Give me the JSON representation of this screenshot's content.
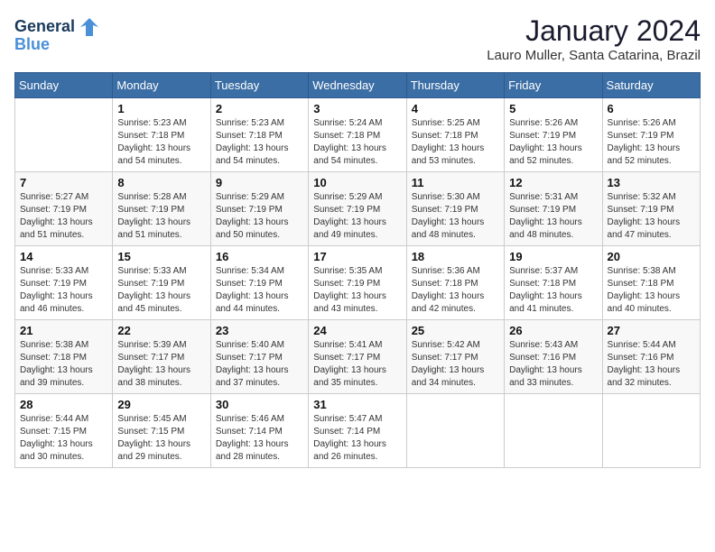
{
  "header": {
    "logo_line1": "General",
    "logo_line2": "Blue",
    "title": "January 2024",
    "subtitle": "Lauro Muller, Santa Catarina, Brazil"
  },
  "weekdays": [
    "Sunday",
    "Monday",
    "Tuesday",
    "Wednesday",
    "Thursday",
    "Friday",
    "Saturday"
  ],
  "weeks": [
    [
      {
        "day": "",
        "sunrise": "",
        "sunset": "",
        "daylight": ""
      },
      {
        "day": "1",
        "sunrise": "Sunrise: 5:23 AM",
        "sunset": "Sunset: 7:18 PM",
        "daylight": "Daylight: 13 hours and 54 minutes."
      },
      {
        "day": "2",
        "sunrise": "Sunrise: 5:23 AM",
        "sunset": "Sunset: 7:18 PM",
        "daylight": "Daylight: 13 hours and 54 minutes."
      },
      {
        "day": "3",
        "sunrise": "Sunrise: 5:24 AM",
        "sunset": "Sunset: 7:18 PM",
        "daylight": "Daylight: 13 hours and 54 minutes."
      },
      {
        "day": "4",
        "sunrise": "Sunrise: 5:25 AM",
        "sunset": "Sunset: 7:18 PM",
        "daylight": "Daylight: 13 hours and 53 minutes."
      },
      {
        "day": "5",
        "sunrise": "Sunrise: 5:26 AM",
        "sunset": "Sunset: 7:19 PM",
        "daylight": "Daylight: 13 hours and 52 minutes."
      },
      {
        "day": "6",
        "sunrise": "Sunrise: 5:26 AM",
        "sunset": "Sunset: 7:19 PM",
        "daylight": "Daylight: 13 hours and 52 minutes."
      }
    ],
    [
      {
        "day": "7",
        "sunrise": "Sunrise: 5:27 AM",
        "sunset": "Sunset: 7:19 PM",
        "daylight": "Daylight: 13 hours and 51 minutes."
      },
      {
        "day": "8",
        "sunrise": "Sunrise: 5:28 AM",
        "sunset": "Sunset: 7:19 PM",
        "daylight": "Daylight: 13 hours and 51 minutes."
      },
      {
        "day": "9",
        "sunrise": "Sunrise: 5:29 AM",
        "sunset": "Sunset: 7:19 PM",
        "daylight": "Daylight: 13 hours and 50 minutes."
      },
      {
        "day": "10",
        "sunrise": "Sunrise: 5:29 AM",
        "sunset": "Sunset: 7:19 PM",
        "daylight": "Daylight: 13 hours and 49 minutes."
      },
      {
        "day": "11",
        "sunrise": "Sunrise: 5:30 AM",
        "sunset": "Sunset: 7:19 PM",
        "daylight": "Daylight: 13 hours and 48 minutes."
      },
      {
        "day": "12",
        "sunrise": "Sunrise: 5:31 AM",
        "sunset": "Sunset: 7:19 PM",
        "daylight": "Daylight: 13 hours and 48 minutes."
      },
      {
        "day": "13",
        "sunrise": "Sunrise: 5:32 AM",
        "sunset": "Sunset: 7:19 PM",
        "daylight": "Daylight: 13 hours and 47 minutes."
      }
    ],
    [
      {
        "day": "14",
        "sunrise": "Sunrise: 5:33 AM",
        "sunset": "Sunset: 7:19 PM",
        "daylight": "Daylight: 13 hours and 46 minutes."
      },
      {
        "day": "15",
        "sunrise": "Sunrise: 5:33 AM",
        "sunset": "Sunset: 7:19 PM",
        "daylight": "Daylight: 13 hours and 45 minutes."
      },
      {
        "day": "16",
        "sunrise": "Sunrise: 5:34 AM",
        "sunset": "Sunset: 7:19 PM",
        "daylight": "Daylight: 13 hours and 44 minutes."
      },
      {
        "day": "17",
        "sunrise": "Sunrise: 5:35 AM",
        "sunset": "Sunset: 7:19 PM",
        "daylight": "Daylight: 13 hours and 43 minutes."
      },
      {
        "day": "18",
        "sunrise": "Sunrise: 5:36 AM",
        "sunset": "Sunset: 7:18 PM",
        "daylight": "Daylight: 13 hours and 42 minutes."
      },
      {
        "day": "19",
        "sunrise": "Sunrise: 5:37 AM",
        "sunset": "Sunset: 7:18 PM",
        "daylight": "Daylight: 13 hours and 41 minutes."
      },
      {
        "day": "20",
        "sunrise": "Sunrise: 5:38 AM",
        "sunset": "Sunset: 7:18 PM",
        "daylight": "Daylight: 13 hours and 40 minutes."
      }
    ],
    [
      {
        "day": "21",
        "sunrise": "Sunrise: 5:38 AM",
        "sunset": "Sunset: 7:18 PM",
        "daylight": "Daylight: 13 hours and 39 minutes."
      },
      {
        "day": "22",
        "sunrise": "Sunrise: 5:39 AM",
        "sunset": "Sunset: 7:17 PM",
        "daylight": "Daylight: 13 hours and 38 minutes."
      },
      {
        "day": "23",
        "sunrise": "Sunrise: 5:40 AM",
        "sunset": "Sunset: 7:17 PM",
        "daylight": "Daylight: 13 hours and 37 minutes."
      },
      {
        "day": "24",
        "sunrise": "Sunrise: 5:41 AM",
        "sunset": "Sunset: 7:17 PM",
        "daylight": "Daylight: 13 hours and 35 minutes."
      },
      {
        "day": "25",
        "sunrise": "Sunrise: 5:42 AM",
        "sunset": "Sunset: 7:17 PM",
        "daylight": "Daylight: 13 hours and 34 minutes."
      },
      {
        "day": "26",
        "sunrise": "Sunrise: 5:43 AM",
        "sunset": "Sunset: 7:16 PM",
        "daylight": "Daylight: 13 hours and 33 minutes."
      },
      {
        "day": "27",
        "sunrise": "Sunrise: 5:44 AM",
        "sunset": "Sunset: 7:16 PM",
        "daylight": "Daylight: 13 hours and 32 minutes."
      }
    ],
    [
      {
        "day": "28",
        "sunrise": "Sunrise: 5:44 AM",
        "sunset": "Sunset: 7:15 PM",
        "daylight": "Daylight: 13 hours and 30 minutes."
      },
      {
        "day": "29",
        "sunrise": "Sunrise: 5:45 AM",
        "sunset": "Sunset: 7:15 PM",
        "daylight": "Daylight: 13 hours and 29 minutes."
      },
      {
        "day": "30",
        "sunrise": "Sunrise: 5:46 AM",
        "sunset": "Sunset: 7:14 PM",
        "daylight": "Daylight: 13 hours and 28 minutes."
      },
      {
        "day": "31",
        "sunrise": "Sunrise: 5:47 AM",
        "sunset": "Sunset: 7:14 PM",
        "daylight": "Daylight: 13 hours and 26 minutes."
      },
      {
        "day": "",
        "sunrise": "",
        "sunset": "",
        "daylight": ""
      },
      {
        "day": "",
        "sunrise": "",
        "sunset": "",
        "daylight": ""
      },
      {
        "day": "",
        "sunrise": "",
        "sunset": "",
        "daylight": ""
      }
    ]
  ]
}
